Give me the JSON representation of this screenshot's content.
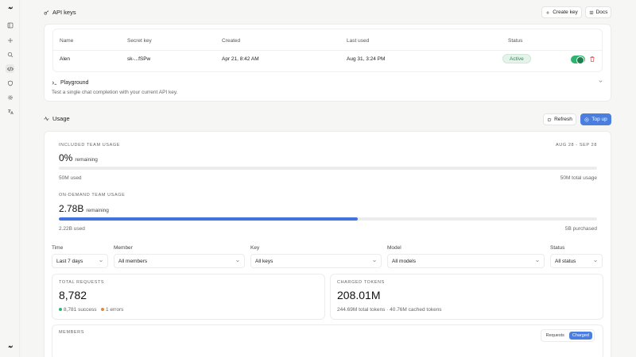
{
  "sidebar": {
    "icons": [
      "logo-icon",
      "panel-icon",
      "plus-icon",
      "search-icon",
      "code-icon",
      "shield-icon",
      "gear-icon",
      "translate-icon"
    ]
  },
  "api_keys": {
    "title": "API keys",
    "create_key": "Create key",
    "docs": "Docs",
    "columns": [
      "Name",
      "Secret key",
      "Created",
      "Last used",
      "Status"
    ],
    "row": {
      "name": "Alen",
      "secret": "sk-...fSPw",
      "created": "Apr 21, 8:42 AM",
      "last_used": "Aug 31, 3:24 PM",
      "status": "Active"
    },
    "playground": {
      "title": "Playground",
      "desc": "Test a single chat completion with your current API key."
    }
  },
  "usage": {
    "title": "Usage",
    "refresh": "Refresh",
    "top_up": "Top up",
    "included": {
      "label": "Included team usage",
      "range": "Aug 28 - Sep 28",
      "value": "0%",
      "suffix": "remaining",
      "progress": 0,
      "used": "50M used",
      "total": "50M total usage"
    },
    "on_demand": {
      "label": "On-demand team usage",
      "value": "2.78B",
      "suffix": "remaining",
      "progress": 0.555,
      "used": "2.22B used",
      "total": "5B purchased"
    }
  },
  "filters": {
    "time": {
      "label": "Time",
      "value": "Last 7 days"
    },
    "member": {
      "label": "Member",
      "value": "All members"
    },
    "key": {
      "label": "Key",
      "value": "All keys"
    },
    "model": {
      "label": "Model",
      "value": "All models"
    },
    "status": {
      "label": "Status",
      "value": "All status"
    }
  },
  "stats": {
    "total_requests": {
      "label": "Total requests",
      "value": "8,782",
      "success": "8,781 success",
      "errors": "1 errors",
      "success_color": "#2db36f",
      "error_color": "#e0873a"
    },
    "charged_tokens": {
      "label": "Charged tokens",
      "value": "208.01M",
      "total": "244.69M total tokens",
      "sep": "·",
      "cached": "40.76M cached tokens"
    }
  },
  "members": {
    "label": "Members",
    "toggle": [
      "Requests",
      "Charged"
    ]
  }
}
